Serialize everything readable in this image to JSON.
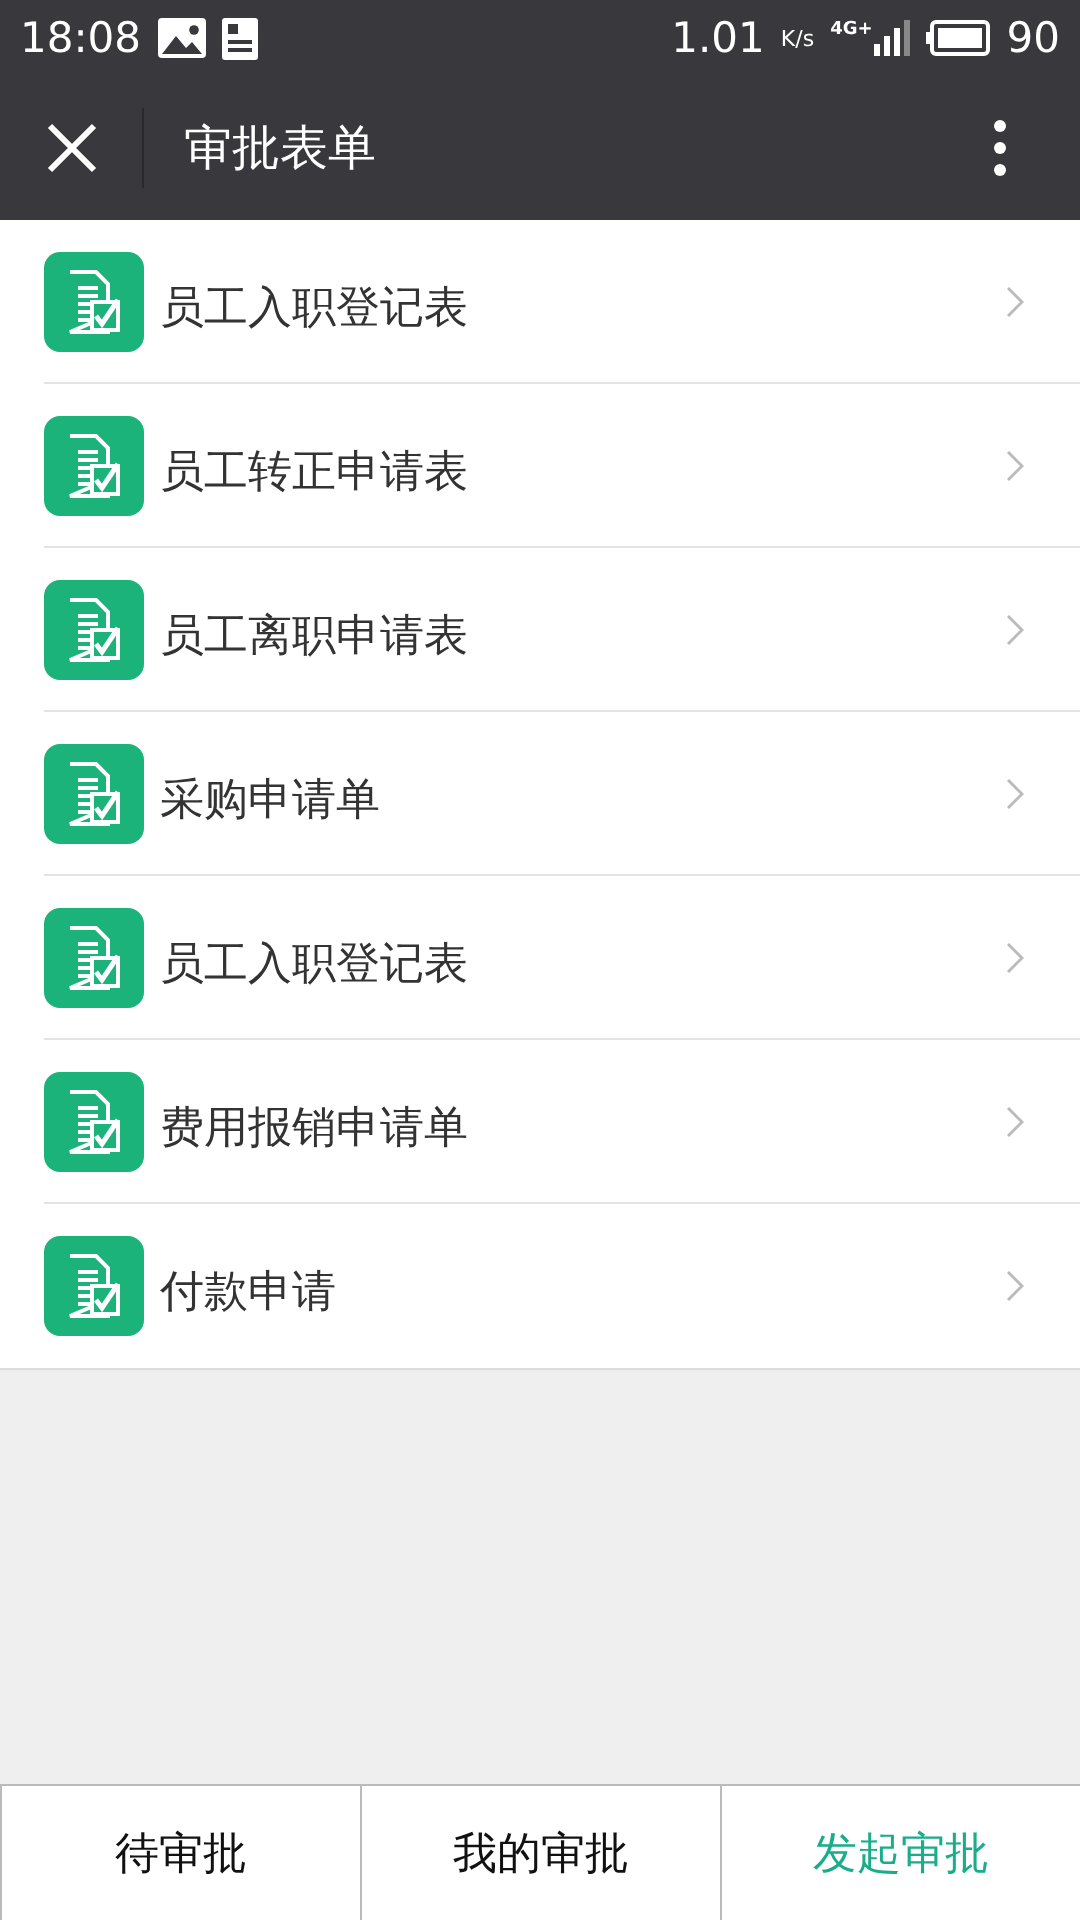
{
  "status_bar": {
    "time": "18:08",
    "speed": "1.01",
    "speed_unit": "K/s",
    "network": "4G+",
    "battery": "90"
  },
  "header": {
    "title": "审批表单"
  },
  "forms": [
    {
      "label": "员工入职登记表"
    },
    {
      "label": "员工转正申请表"
    },
    {
      "label": "员工离职申请表"
    },
    {
      "label": "采购申请单"
    },
    {
      "label": "员工入职登记表"
    },
    {
      "label": "费用报销申请单"
    },
    {
      "label": "付款申请"
    }
  ],
  "tabs": [
    {
      "label": "待审批",
      "selected": false
    },
    {
      "label": "我的审批",
      "selected": false
    },
    {
      "label": "发起审批",
      "selected": true
    }
  ]
}
